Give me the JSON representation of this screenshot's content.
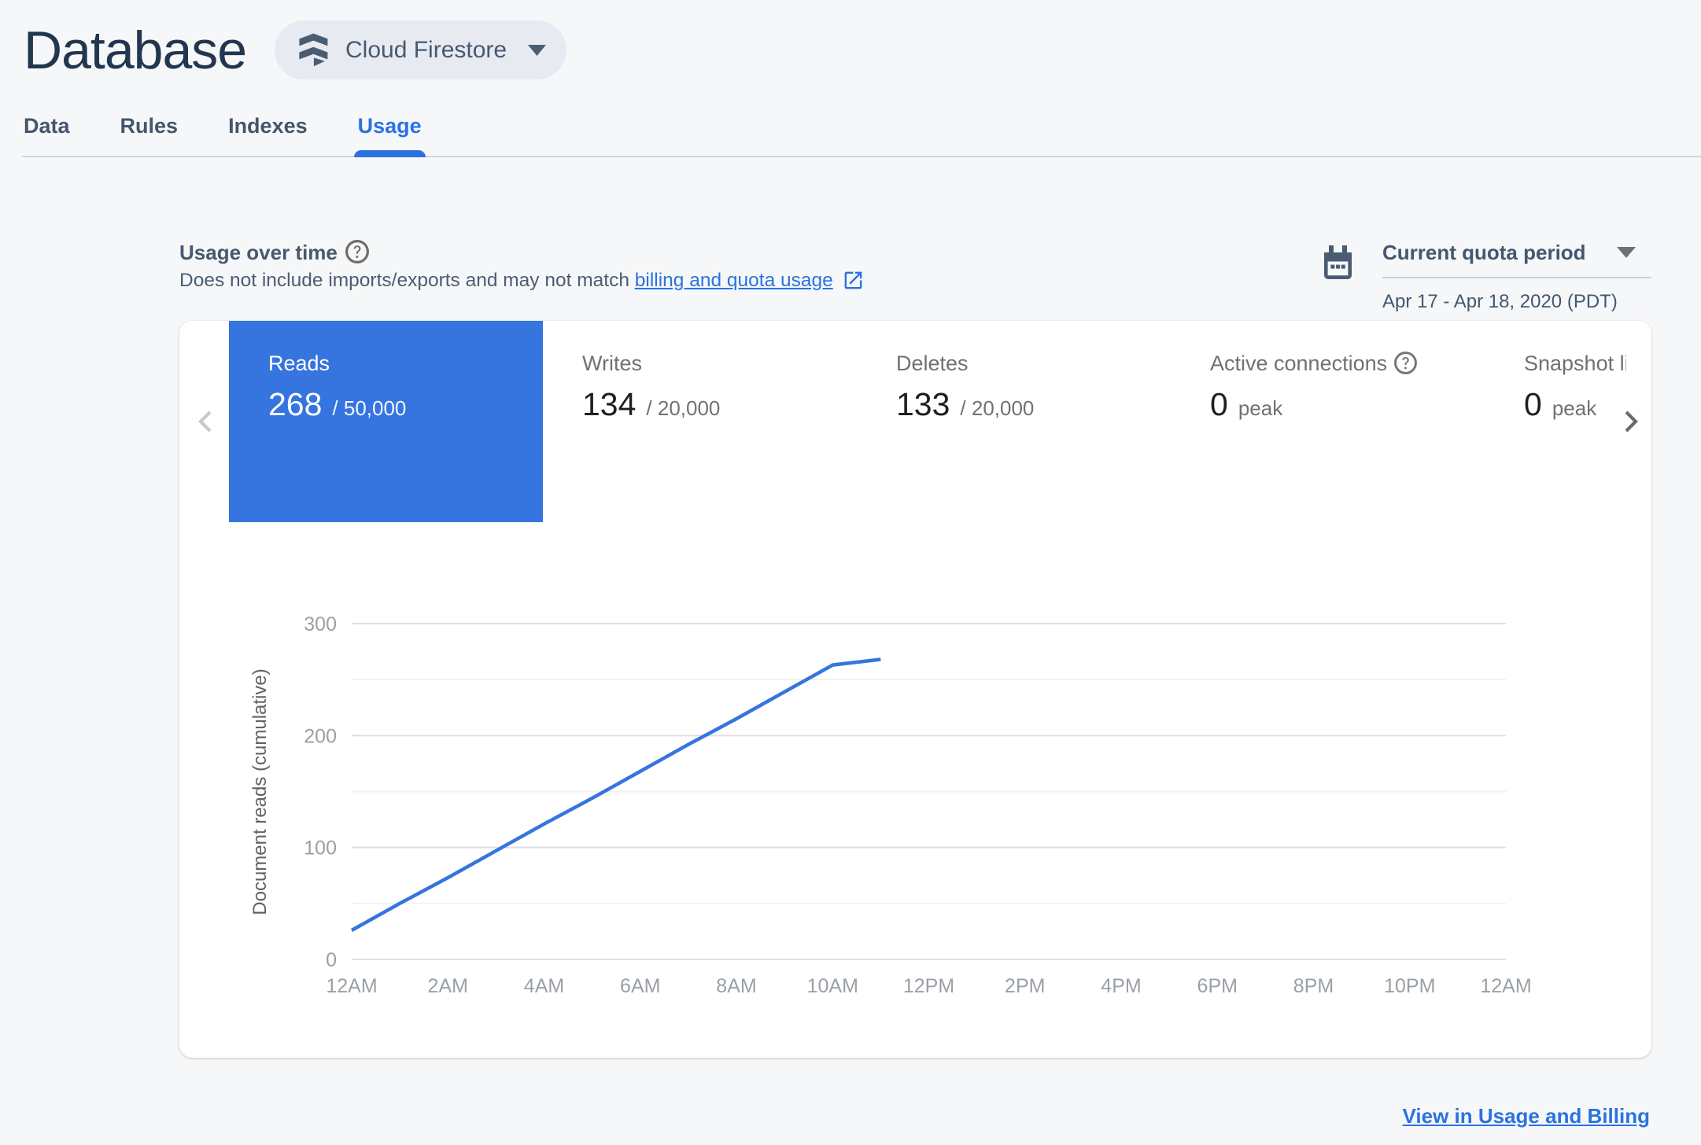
{
  "header": {
    "title": "Database",
    "product_selector": {
      "label": "Cloud Firestore"
    }
  },
  "tabs": {
    "items": [
      {
        "label": "Data",
        "active": false
      },
      {
        "label": "Rules",
        "active": false
      },
      {
        "label": "Indexes",
        "active": false
      },
      {
        "label": "Usage",
        "active": true
      }
    ]
  },
  "usage_section": {
    "heading": "Usage over time",
    "description_prefix": "Does not include imports/exports and may not match",
    "link_text": "billing and quota usage",
    "period_selector": {
      "label": "Current quota period",
      "range": "Apr 17 - Apr 18, 2020 (PDT)"
    }
  },
  "metrics": {
    "items": [
      {
        "label": "Reads",
        "value": "268",
        "secondary": "/ 50,000",
        "selected": true
      },
      {
        "label": "Writes",
        "value": "134",
        "secondary": "/ 20,000",
        "selected": false
      },
      {
        "label": "Deletes",
        "value": "133",
        "secondary": "/ 20,000",
        "selected": false
      },
      {
        "label": "Active connections",
        "value": "0",
        "secondary": "peak",
        "selected": false
      },
      {
        "label": "Snapshot listeners",
        "value": "0",
        "secondary": "peak",
        "selected": false
      }
    ]
  },
  "chart_data": {
    "type": "line",
    "title": "",
    "xlabel": "",
    "ylabel": "Document reads (cumulative)",
    "x_tick_labels": [
      "12AM",
      "2AM",
      "4AM",
      "6AM",
      "8AM",
      "10AM",
      "12PM",
      "2PM",
      "4PM",
      "6PM",
      "8PM",
      "10PM",
      "12AM"
    ],
    "x_axis_hours": [
      0,
      24
    ],
    "ylim": [
      0,
      300
    ],
    "y_ticks": [
      0,
      100,
      200,
      300
    ],
    "y_minor_ticks": [
      50,
      150,
      250
    ],
    "grid": true,
    "legend": "none",
    "line_color": "#3674df",
    "series": [
      {
        "name": "Document reads (cumulative)",
        "x_hours": [
          0,
          1,
          2,
          3,
          4,
          5,
          6,
          7,
          8,
          9,
          10,
          11
        ],
        "values": [
          26,
          50,
          73,
          97,
          121,
          144,
          168,
          192,
          215,
          239,
          263,
          268
        ]
      }
    ]
  },
  "footer": {
    "link": "View in Usage and Billing"
  },
  "colors": {
    "accent_blue": "#2a72e0",
    "selected_metric_blue": "#3674df",
    "page_background": "#f6f7f9"
  }
}
